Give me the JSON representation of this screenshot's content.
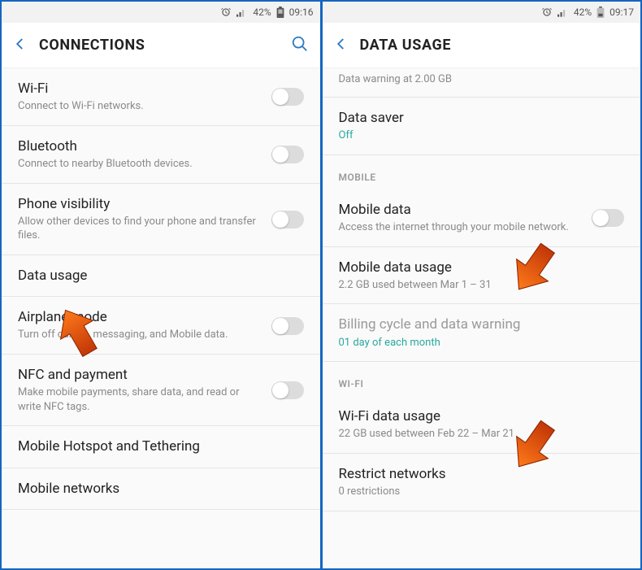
{
  "left": {
    "status": {
      "battery": "42%",
      "time": "09:16"
    },
    "header": {
      "title": "CONNECTIONS"
    },
    "items": [
      {
        "label": "Wi-Fi",
        "sub": "Connect to Wi-Fi networks.",
        "toggle": true
      },
      {
        "label": "Bluetooth",
        "sub": "Connect to nearby Bluetooth devices.",
        "toggle": true
      },
      {
        "label": "Phone visibility",
        "sub": "Allow other devices to find your phone and transfer files.",
        "toggle": true
      },
      {
        "label": "Data usage",
        "sub": "",
        "toggle": false
      },
      {
        "label": "Airplane mode",
        "sub": "Turn off calling, messaging, and Mobile data.",
        "toggle": true
      },
      {
        "label": "NFC and payment",
        "sub": "Make mobile payments, share data, and read or write NFC tags.",
        "toggle": true
      },
      {
        "label": "Mobile Hotspot and Tethering",
        "sub": "",
        "toggle": false
      },
      {
        "label": "Mobile networks",
        "sub": "",
        "toggle": false
      }
    ]
  },
  "right": {
    "status": {
      "battery": "42%",
      "time": "09:17"
    },
    "header": {
      "title": "DATA USAGE"
    },
    "note": "Data warning at 2.00 GB",
    "data_saver": {
      "label": "Data saver",
      "value": "Off"
    },
    "sections": {
      "mobile": {
        "title": "MOBILE",
        "items": [
          {
            "label": "Mobile data",
            "sub": "Access the internet through your mobile network.",
            "toggle": true
          },
          {
            "label": "Mobile data usage",
            "sub": "2.2 GB used between Mar 1 – 31",
            "toggle": false
          },
          {
            "label": "Billing cycle and data warning",
            "sub": "01 day of each month",
            "toggle": false,
            "teal": true
          }
        ]
      },
      "wifi": {
        "title": "WI-FI",
        "items": [
          {
            "label": "Wi-Fi data usage",
            "sub": "22 GB used between Feb 22 – Mar 21",
            "toggle": false
          },
          {
            "label": "Restrict networks",
            "sub": "0 restrictions",
            "toggle": false
          }
        ]
      }
    }
  }
}
